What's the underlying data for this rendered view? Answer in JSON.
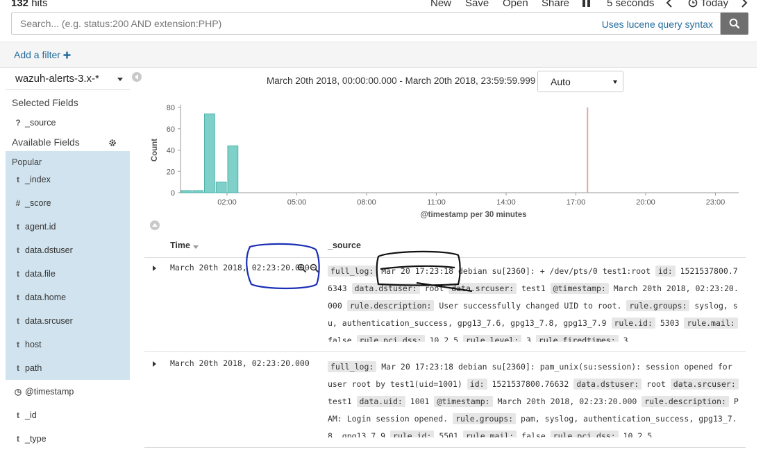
{
  "topbar": {
    "hits_count": "132",
    "hits_label": "hits",
    "nav": {
      "new": "New",
      "save": "Save",
      "open": "Open",
      "share": "Share",
      "refresh_interval": "5 seconds",
      "time_range": "Today"
    }
  },
  "search": {
    "placeholder": "Search... (e.g. status:200 AND extension:PHP)",
    "syntax_link": "Uses lucene query syntax"
  },
  "filter": {
    "add_label": "Add a filter"
  },
  "sidebar": {
    "index_pattern": "wazuh-alerts-3.x-*",
    "selected_title": "Selected Fields",
    "selected_fields": [
      {
        "type": "?",
        "name": "_source"
      }
    ],
    "available_title": "Available Fields",
    "popular_title": "Popular",
    "popular_fields": [
      {
        "type": "t",
        "name": "_index"
      },
      {
        "type": "#",
        "name": "_score"
      },
      {
        "type": "t",
        "name": "agent.id"
      },
      {
        "type": "t",
        "name": "data.dstuser"
      },
      {
        "type": "t",
        "name": "data.file"
      },
      {
        "type": "t",
        "name": "data.home"
      },
      {
        "type": "t",
        "name": "data.srcuser"
      },
      {
        "type": "t",
        "name": "host"
      },
      {
        "type": "t",
        "name": "path"
      }
    ],
    "other_fields": [
      {
        "type": "◷",
        "name": "@timestamp"
      },
      {
        "type": "t",
        "name": "_id"
      },
      {
        "type": "t",
        "name": "_type"
      }
    ]
  },
  "histogram": {
    "range_text": "March 20th 2018, 00:00:00.000 - March 20th 2018, 23:59:59.999 —",
    "interval": "Auto"
  },
  "chart_data": {
    "type": "bar",
    "xlabel": "@timestamp per 30 minutes",
    "ylabel": "Count",
    "ylim": [
      0,
      80
    ],
    "yticks": [
      0,
      20,
      40,
      60,
      80
    ],
    "xticks": [
      "02:00",
      "05:00",
      "08:00",
      "11:00",
      "14:00",
      "17:00",
      "20:00",
      "23:00"
    ],
    "xtick_hours": [
      2,
      5,
      8,
      11,
      14,
      17,
      20,
      23
    ],
    "bucket_hours": 0.5,
    "x_start_hour": 0,
    "x_end_hour": 24,
    "bars": [
      {
        "start_hour": 0.0,
        "value": 2
      },
      {
        "start_hour": 0.5,
        "value": 2
      },
      {
        "start_hour": 1.0,
        "value": 74
      },
      {
        "start_hour": 1.5,
        "value": 10
      },
      {
        "start_hour": 2.0,
        "value": 44
      }
    ],
    "now_marker_hour": 17.5,
    "colors": {
      "bar": "#7fd0c8",
      "bar_stroke": "#4bb3aa",
      "marker": "#e8a4a4",
      "axis": "#999999"
    }
  },
  "table": {
    "col_time": "Time",
    "col_source": "_source",
    "rows": [
      {
        "time": "March 20th 2018, 02:23:20.000",
        "source": [
          {
            "k": "full_log:",
            "v": " Mar 20 17:23:18 debian su[2360]: + /dev/pts/0 test1:root "
          },
          {
            "k": "id:",
            "v": " 1521537800.76343 "
          },
          {
            "k": "data.dstuser:",
            "v": " root "
          },
          {
            "k": "data.srcuser:",
            "v": " test1 "
          },
          {
            "k": "@timestamp:",
            "v": " March 20th 2018, 02:23:20.000 "
          },
          {
            "k": "rule.description:",
            "v": " User successfully changed UID to root. "
          },
          {
            "k": "rule.groups:",
            "v": " syslog, su, authentication_success, gpg13_7.6, gpg13_7.8, gpg13_7.9 "
          },
          {
            "k": "rule.id:",
            "v": " 5303 "
          },
          {
            "k": "rule.mail:",
            "v": " false "
          },
          {
            "k": "rule.pci_dss:",
            "v": " 10.2.5 "
          },
          {
            "k": "rule.level:",
            "v": " 3 "
          },
          {
            "k": "rule.firedtimes:",
            "v": " 3"
          }
        ]
      },
      {
        "time": "March 20th 2018, 02:23:20.000",
        "source": [
          {
            "k": "full_log:",
            "v": " Mar 20 17:23:18 debian su[2360]: pam_unix(su:session): session opened for user root by test1(uid=1001) "
          },
          {
            "k": "id:",
            "v": " 1521537800.76632 "
          },
          {
            "k": "data.dstuser:",
            "v": " root "
          },
          {
            "k": "data.srcuser:",
            "v": " test1 "
          },
          {
            "k": "data.uid:",
            "v": " 1001 "
          },
          {
            "k": "@timestamp:",
            "v": " March 20th 2018, 02:23:20.000 "
          },
          {
            "k": "rule.description:",
            "v": " PAM: Login session opened. "
          },
          {
            "k": "rule.groups:",
            "v": " pam, syslog, authentication_success, gpg13_7.8, gpg13_7.9 "
          },
          {
            "k": "rule.id:",
            "v": " 5501 "
          },
          {
            "k": "rule.mail:",
            "v": " false "
          },
          {
            "k": "rule.pci_dss:",
            "v": " 10.2.5"
          }
        ]
      }
    ]
  }
}
